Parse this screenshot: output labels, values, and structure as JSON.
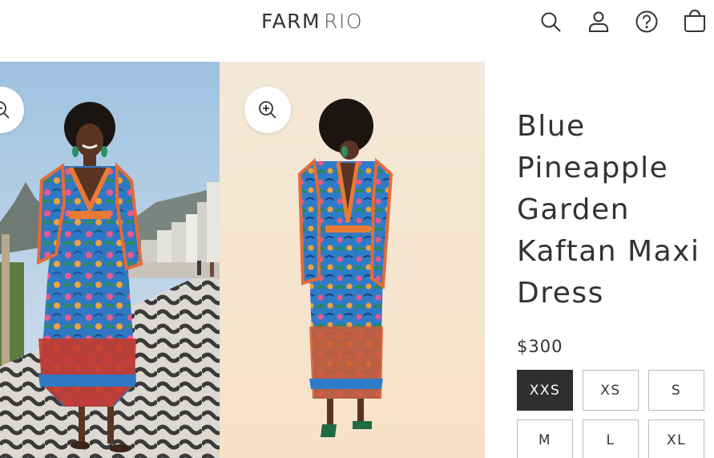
{
  "header": {
    "logo_main": "FARM",
    "logo_sub": "RIO",
    "icons": [
      "search-icon",
      "account-icon",
      "help-icon",
      "cart-icon"
    ]
  },
  "gallery": {
    "zoom_icon": "zoom-in-icon"
  },
  "product": {
    "title_lines": [
      "Blue",
      "Pineapple",
      "Garden",
      "Kaftan Maxi",
      "Dress"
    ],
    "price": "$300",
    "sizes": [
      "XXS",
      "XS",
      "S",
      "M",
      "L",
      "XL"
    ],
    "selected_size": "XXS"
  },
  "colors": {
    "selected_size_bg": "#2f2f2f",
    "text": "#333333",
    "border": "#bbbbbb"
  }
}
